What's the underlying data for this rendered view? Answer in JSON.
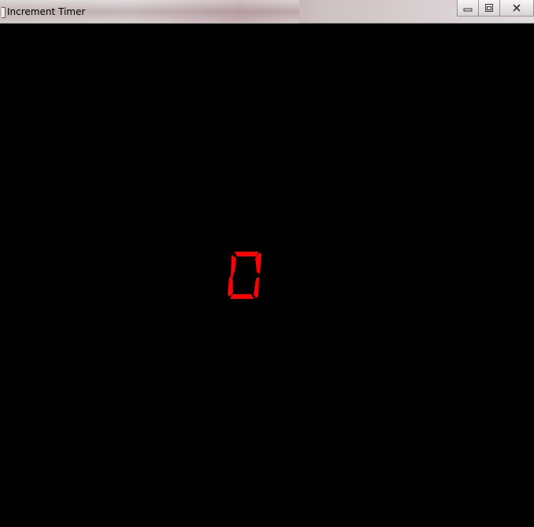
{
  "window": {
    "title": "Increment Timer",
    "controls": {
      "minimize_icon": "minimize-icon",
      "maximize_icon": "restore-icon",
      "close_icon": "close-icon"
    }
  },
  "display": {
    "value": "0",
    "color": "#ff0000",
    "style": "seven-segment"
  }
}
